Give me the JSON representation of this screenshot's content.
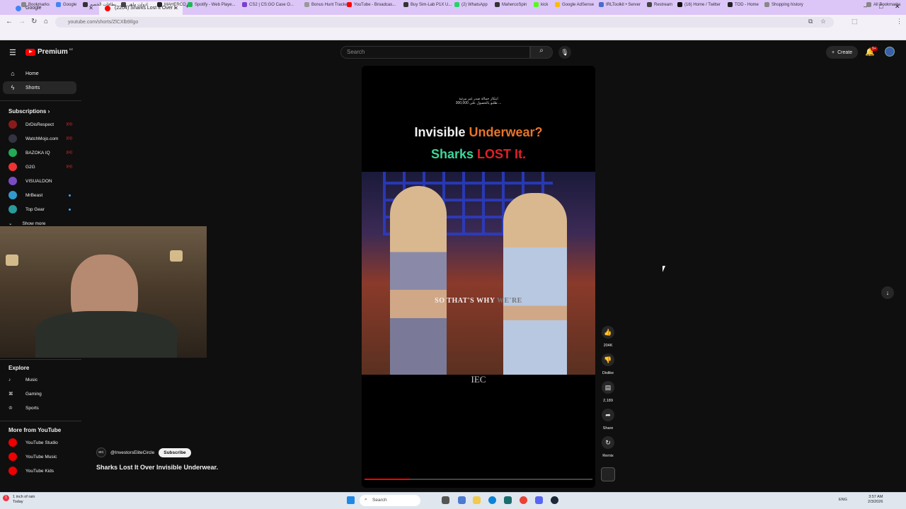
{
  "browser": {
    "tabs": [
      {
        "label": "Google"
      },
      {
        "label": "(2204) Sharks Lost It Over I"
      }
    ],
    "url": "youtube.com/shorts/ZlCXlb9Ilgo",
    "bookmarks": [
      "Bookmarks",
      "Google",
      "بطاقات الخصم",
      "ادوات ماهر",
      "MAHERCO",
      "Spotify - Web Playe...",
      "CS2 | CS:GO Case O...",
      "Bonus Hunt Tracker",
      "YouTube - Broadcas...",
      "Buy Sim-Lab P1X U...",
      "(2) WhatsApp",
      "MahercoSpin",
      "kick",
      "Google AdSense",
      "IRLToolkit • Server",
      "Restream",
      "(16) Home / Twitter",
      "TOD - Home",
      "Shopping history"
    ],
    "all_bookmarks": "All Bookmarks"
  },
  "header": {
    "brand": "Premium",
    "brand_badge": "DZ",
    "search_placeholder": "Search",
    "create_label": "Create",
    "notif_count": "9+"
  },
  "sidebar": {
    "home": "Home",
    "shorts": "Shorts",
    "subscriptions": "Subscriptions",
    "subs": [
      {
        "name": "DrDisRespect",
        "color": "#8b1a1a",
        "status": "live"
      },
      {
        "name": "WatchMojo.com",
        "color": "#334",
        "status": "live"
      },
      {
        "name": "BAZOKA IQ",
        "color": "#2a5",
        "status": "live"
      },
      {
        "name": "G2G",
        "color": "#e33",
        "status": "live"
      },
      {
        "name": "VISUALDON",
        "color": "#7a4cc2",
        "status": ""
      },
      {
        "name": "MrBeast",
        "color": "#39c",
        "status": "dot"
      },
      {
        "name": "Top Gear",
        "color": "#2a9a9a",
        "status": "dot"
      }
    ],
    "show_more": "Show more",
    "live_label": "((•))",
    "explore": "Explore",
    "music": "Music",
    "gaming": "Gaming",
    "sports": "Sports",
    "more_from": "More from YouTube",
    "studio": "YouTube Studio",
    "yt_music": "YouTube Music",
    "kids": "YouTube Kids"
  },
  "short": {
    "arabic_line1": "ابتكار حمالة صدر غير مرئية",
    "arabic_line2": "300,000 طلبو بالحصول على ...",
    "title_line1_a": "Invisible ",
    "title_line1_b": "Underwear?",
    "title_line2_a": "Sharks ",
    "title_line2_b": "LOST It.",
    "caption_a": "SO THAT'S WHY ",
    "caption_b": "WE'RE",
    "watermark": "IEC",
    "progress": 0.2,
    "likes": "204K",
    "dislike": "Dislike",
    "comments": "2,189",
    "share": "Share",
    "remix": "Remix",
    "channel": "@InvestorsEliteCircle",
    "channel_avatar": "IEC",
    "subscribe": "Subscribe",
    "title": "Sharks Lost It Over Invisible Underwear."
  },
  "taskbar": {
    "weather_line1": "1 inch of rain",
    "weather_line2": "Today",
    "weather_badge": "1",
    "search": "Search",
    "lang": "ENG",
    "time": "3:57 AM",
    "date": "2/3/2026"
  },
  "colors": {
    "accent_red": "#ff0000",
    "title_orange": "#e8742a",
    "title_green": "#3ed69a",
    "title_red": "#e0202a"
  }
}
